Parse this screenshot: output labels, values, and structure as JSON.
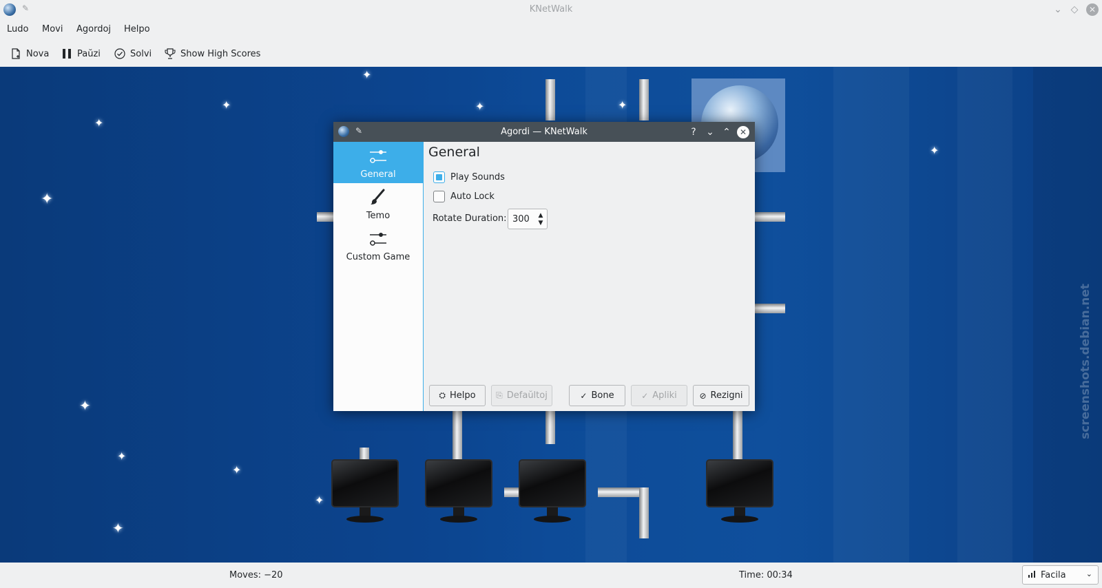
{
  "window": {
    "title": "KNetWalk"
  },
  "menubar": {
    "items": [
      "Ludo",
      "Movi",
      "Agordoj",
      "Helpo"
    ]
  },
  "toolbar": {
    "new_label": "Nova",
    "pause_label": "Paŭzi",
    "solve_label": "Solvi",
    "highscores_label": "Show High Scores"
  },
  "dialog": {
    "title": "Agordi — KNetWalk",
    "sidebar": [
      {
        "label": "General",
        "icon": "sliders-icon",
        "active": true
      },
      {
        "label": "Temo",
        "icon": "paintbrush-icon",
        "active": false
      },
      {
        "label": "Custom Game",
        "icon": "sliders-icon",
        "active": false
      }
    ],
    "page_title": "General",
    "play_sounds_label": "Play Sounds",
    "play_sounds_checked": true,
    "auto_lock_label": "Auto Lock",
    "auto_lock_checked": false,
    "rotate_duration_label": "Rotate Duration:",
    "rotate_duration_value": "300",
    "buttons": {
      "help": "Helpo",
      "defaults": "Defaŭltoj",
      "ok": "Bone",
      "apply": "Apliki",
      "cancel": "Rezigni"
    }
  },
  "statusbar": {
    "moves": "Moves: −20",
    "time": "Time: 00:34",
    "difficulty": "Facila"
  },
  "watermark": "screenshots.debian.net",
  "colors": {
    "accent": "#3daee9",
    "dialog_titlebar": "#475057",
    "game_background": "#0c4590"
  }
}
